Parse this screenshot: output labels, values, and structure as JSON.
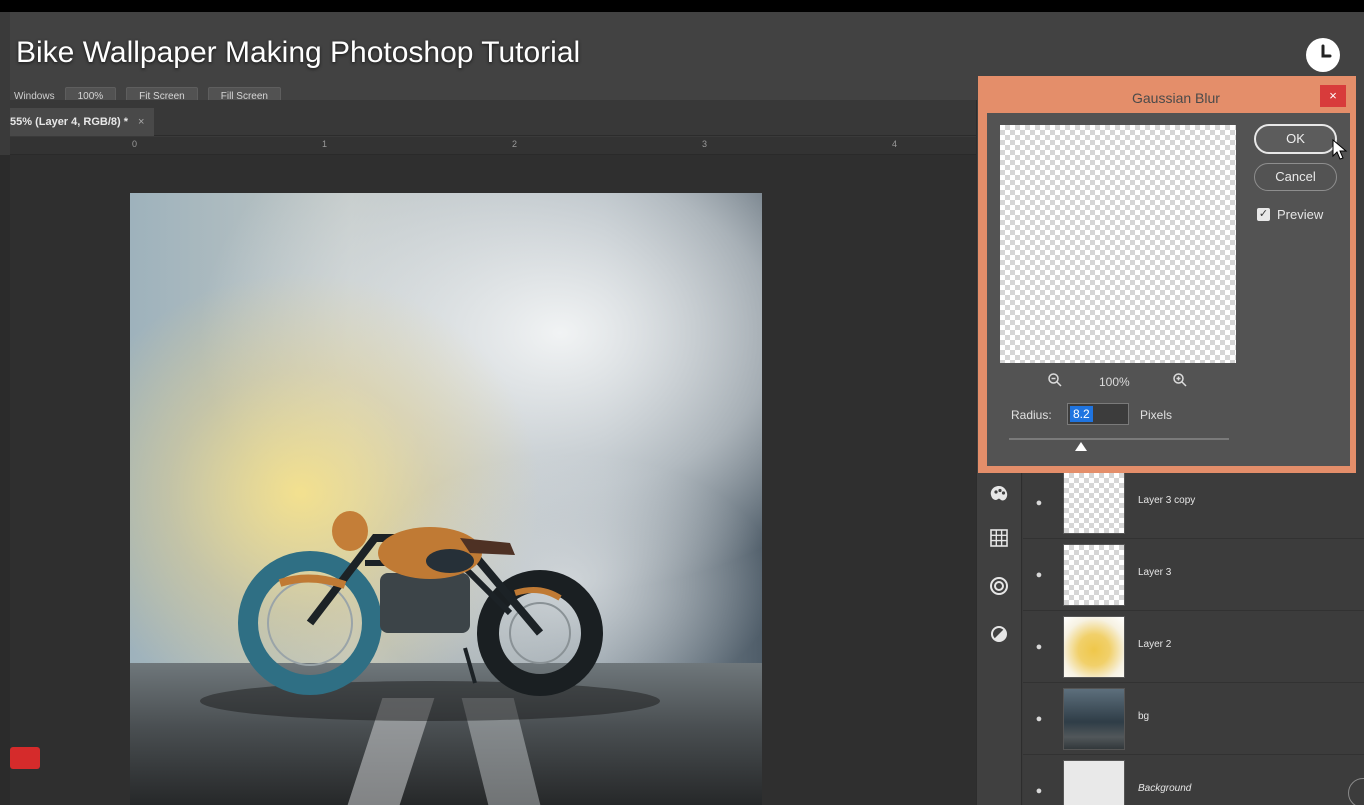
{
  "video": {
    "title": "Bike Wallpaper Making Photoshop Tutorial"
  },
  "optionsbar": {
    "windows_label": "Windows",
    "zoom_btn": "100%",
    "fit_screen_btn": "Fit Screen",
    "fill_screen_btn": "Fill Screen"
  },
  "document": {
    "tab_label": "55% (Layer 4, RGB/8) *",
    "tab_close": "×",
    "ruler_ticks": [
      "0",
      "1",
      "2",
      "3",
      "4"
    ]
  },
  "layers": [
    {
      "name": "Layer 3 copy",
      "thumb": "checker",
      "italic": false
    },
    {
      "name": "Layer 3",
      "thumb": "checker",
      "italic": false
    },
    {
      "name": "Layer 2",
      "thumb": "yellow-glow",
      "italic": false
    },
    {
      "name": "bg",
      "thumb": "storm-sky",
      "italic": false
    },
    {
      "name": "Background",
      "thumb": "white",
      "italic": true
    }
  ],
  "gaussian_blur": {
    "title": "Gaussian Blur",
    "close": "×",
    "ok_label": "OK",
    "cancel_label": "Cancel",
    "preview_label": "Preview",
    "preview_checked": true,
    "zoom_level": "100%",
    "radius_label": "Radius:",
    "radius_value": "8.2",
    "units_label": "Pixels"
  },
  "icons": {
    "clock": "clock-icon",
    "zoom_out": "zoom-out-icon",
    "zoom_in": "zoom-in-icon",
    "eye": "eye-icon",
    "tools": [
      "palette-icon",
      "grid-icon",
      "creative-cloud-icon",
      "adjustment-icon"
    ]
  },
  "colors": {
    "dialog_highlight": "#e48e6a",
    "close_button": "#d83b3b",
    "selection_blue": "#1f74e0",
    "panel_bg": "#3c3c3c"
  }
}
